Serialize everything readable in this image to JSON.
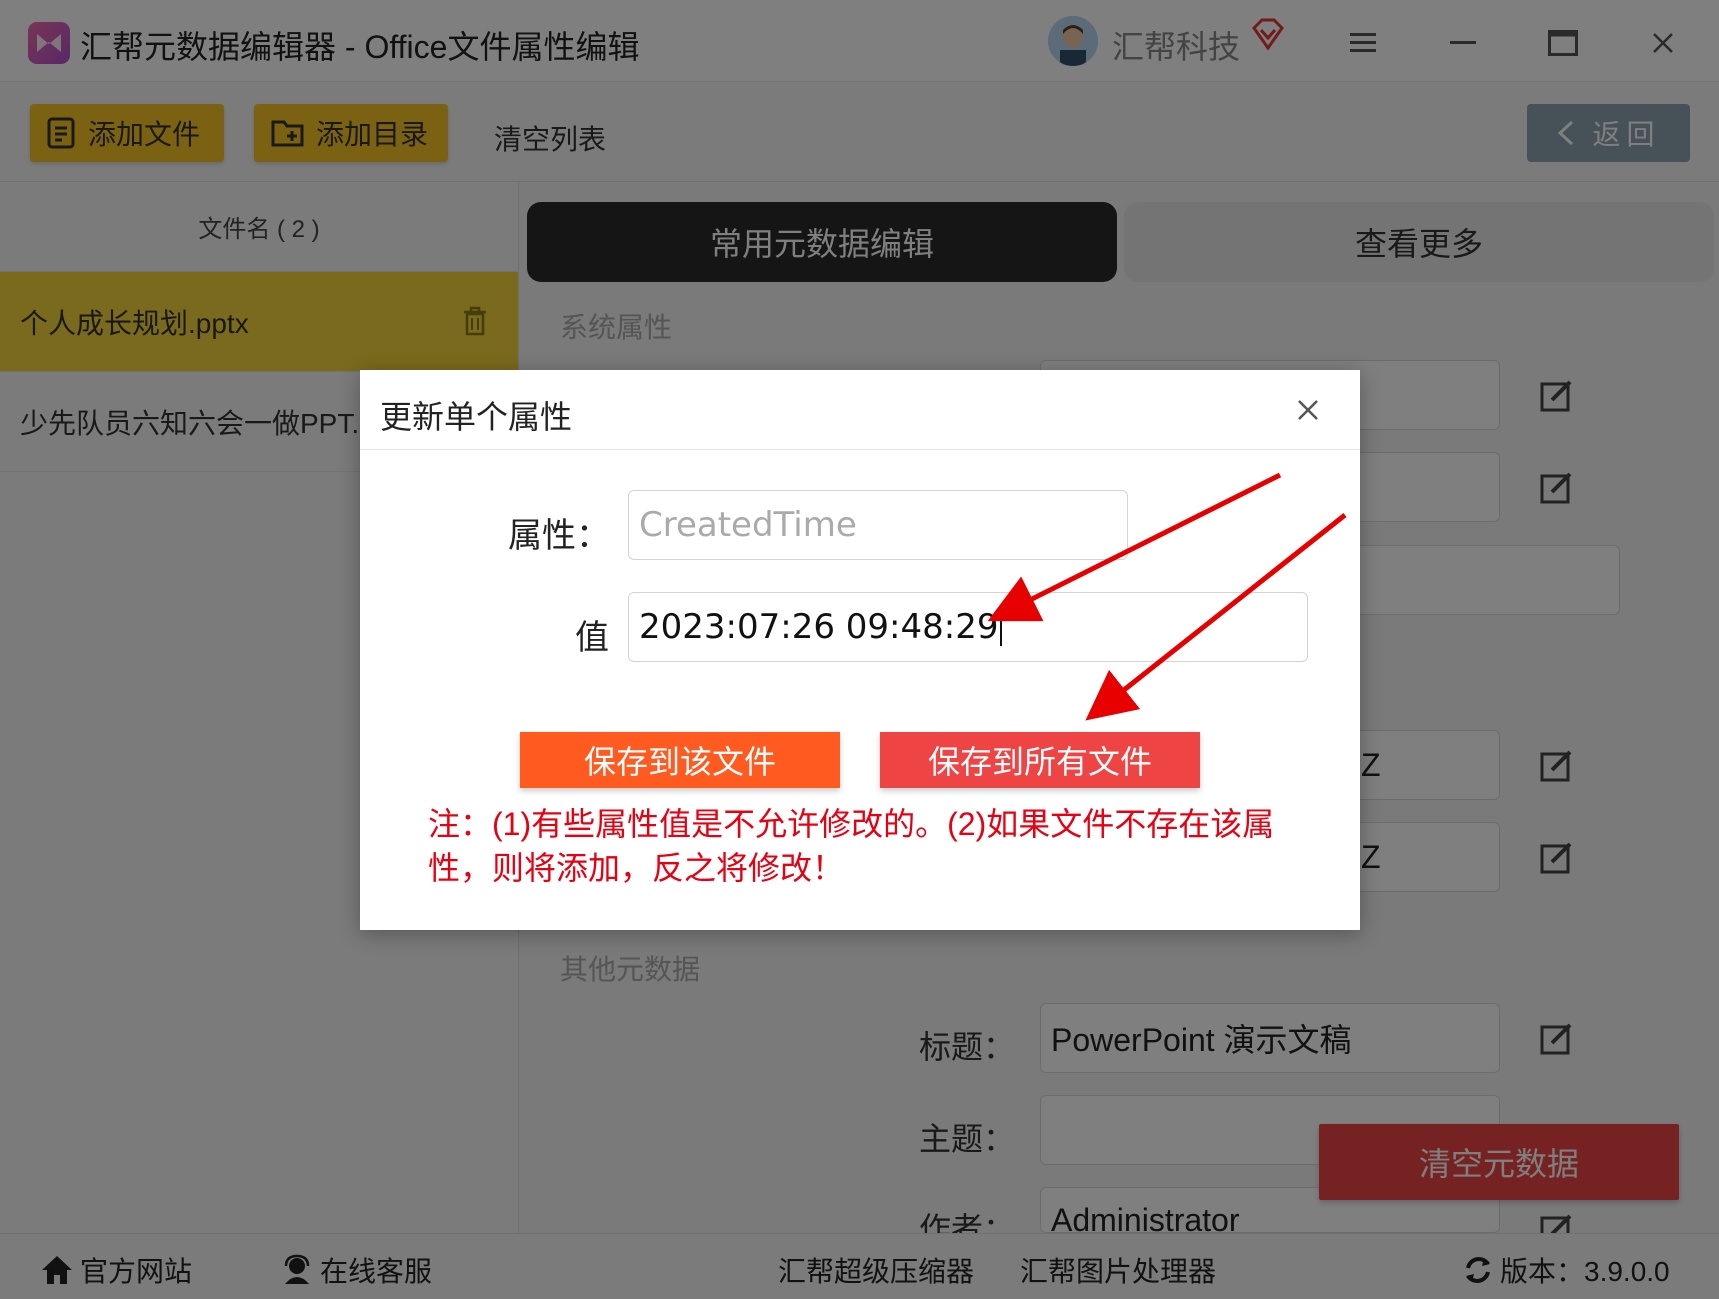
{
  "window": {
    "title": "汇帮元数据编辑器 - Office文件属性编辑",
    "user_name": "汇帮科技"
  },
  "toolbar": {
    "add_file": "添加文件",
    "add_folder": "添加目录",
    "clear_list": "清空列表",
    "back": "返回"
  },
  "file_list": {
    "header": "文件名 ( 2 )",
    "items": [
      {
        "name": "个人成长规划.pptx",
        "selected": true
      },
      {
        "name": "少先队员六知六会一做PPT.pptx",
        "selected": false
      }
    ]
  },
  "tabs": {
    "common": "常用元数据编辑",
    "more": "查看更多"
  },
  "sections": {
    "system": "系统属性",
    "other": "其他元数据"
  },
  "fields": {
    "row_z1": "Z",
    "row_z2": "Z",
    "title_label": "标题：",
    "title_value": "PowerPoint 演示文稿",
    "subject_label": "主题：",
    "subject_value": "",
    "author_label": "作者：",
    "author_value": "Administrator"
  },
  "clear_metadata": "清空元数据",
  "dialog": {
    "title": "更新单个属性",
    "property_label": "属性：",
    "property_placeholder": "CreatedTime",
    "value_label": "值",
    "value": "2023:07:26 09:48:29",
    "save_this": "保存到该文件",
    "save_all": "保存到所有文件",
    "note": "注：(1)有些属性值是不允许修改的。(2)如果文件不存在该属性，则将添加，反之将修改！"
  },
  "statusbar": {
    "website": "官方网站",
    "support": "在线客服",
    "compressor": "汇帮超级压缩器",
    "image_tool": "汇帮图片处理器",
    "version": "版本：3.9.0.0"
  },
  "colors": {
    "accent_yellow": "#f4c524",
    "orange": "#ff5a1f",
    "red": "#ef4444",
    "note_red": "#e60012"
  }
}
